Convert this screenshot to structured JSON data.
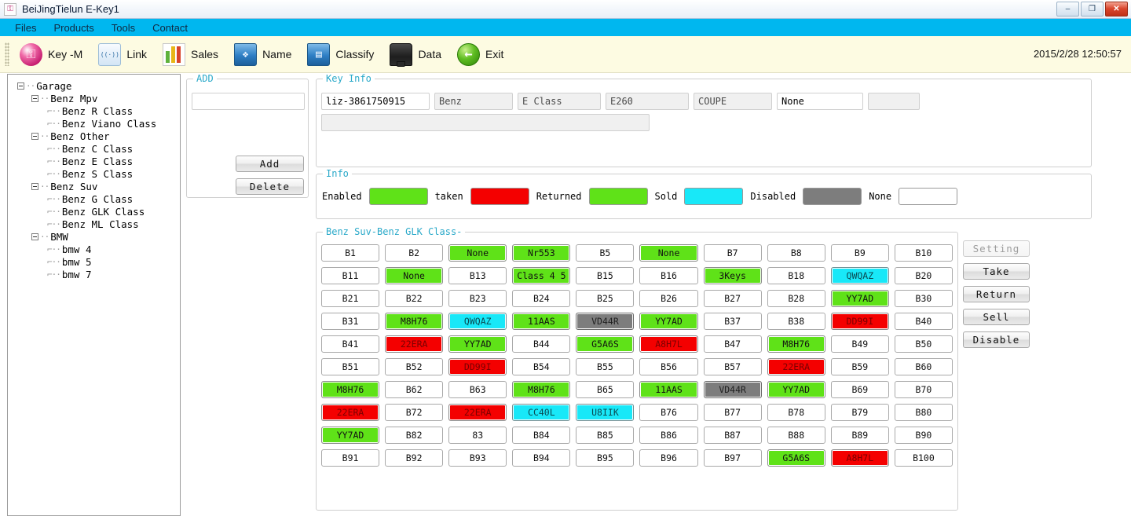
{
  "window": {
    "title": "BeiJingTielun E-Key1",
    "app_icon": "key-app-icon",
    "minimize": "–",
    "maximize": "❐",
    "close": "✕"
  },
  "menubar": {
    "items": [
      {
        "label": "Files"
      },
      {
        "label": "Products"
      },
      {
        "label": "Tools"
      },
      {
        "label": "Contact"
      }
    ]
  },
  "toolbar": {
    "items": [
      {
        "label": "Key -M",
        "icon": "key-icon"
      },
      {
        "label": "Link",
        "icon": "router-icon"
      },
      {
        "label": "Sales",
        "icon": "bar-chart-icon"
      },
      {
        "label": "Name",
        "icon": "blue-folder-icon"
      },
      {
        "label": "Classify",
        "icon": "blue-folder-open-icon"
      },
      {
        "label": "Data",
        "icon": "hard-drive-icon"
      },
      {
        "label": "Exit",
        "icon": "green-back-arrow-icon"
      }
    ],
    "clock": "2015/2/28  12:50:57"
  },
  "tree": {
    "nodes": [
      {
        "label": "Garage",
        "depth": 0,
        "expander": true
      },
      {
        "label": "Benz Mpv",
        "depth": 1,
        "expander": true
      },
      {
        "label": "Benz R Class",
        "depth": 2,
        "expander": false
      },
      {
        "label": "Benz Viano Class",
        "depth": 2,
        "expander": false
      },
      {
        "label": "Benz Other",
        "depth": 1,
        "expander": true
      },
      {
        "label": "Benz C Class",
        "depth": 2,
        "expander": false
      },
      {
        "label": "Benz E Class",
        "depth": 2,
        "expander": false
      },
      {
        "label": "Benz S Class",
        "depth": 2,
        "expander": false
      },
      {
        "label": "Benz Suv",
        "depth": 1,
        "expander": true
      },
      {
        "label": "Benz G Class",
        "depth": 2,
        "expander": false
      },
      {
        "label": "Benz GLK Class",
        "depth": 2,
        "expander": false
      },
      {
        "label": "Benz ML Class",
        "depth": 2,
        "expander": false
      },
      {
        "label": "BMW",
        "depth": 1,
        "expander": true
      },
      {
        "label": "bmw 4",
        "depth": 2,
        "expander": false
      },
      {
        "label": "bmw 5",
        "depth": 2,
        "expander": false
      },
      {
        "label": "bmw 7",
        "depth": 2,
        "expander": false
      }
    ]
  },
  "add_panel": {
    "legend": "ADD",
    "input_value": "",
    "input_placeholder": "",
    "add_label": "Add",
    "delete_label": "Delete"
  },
  "key_info": {
    "legend": "Key Info",
    "fields": [
      {
        "value": "liz-3861750915",
        "state": "active"
      },
      {
        "value": "Benz",
        "state": "readonly"
      },
      {
        "value": "E Class",
        "state": "readonly"
      },
      {
        "value": "E260",
        "state": "readonly"
      },
      {
        "value": "COUPE",
        "state": "readonly"
      },
      {
        "value": "None",
        "state": "active"
      },
      {
        "value": "",
        "state": "readonly"
      }
    ],
    "wide_field": {
      "value": "",
      "state": "readonly"
    }
  },
  "info": {
    "legend": "Info",
    "items": [
      {
        "label": "Enabled",
        "color": "#5fe218"
      },
      {
        "label": "taken",
        "color": "#f40000"
      },
      {
        "label": "Returned",
        "color": "#5fe218"
      },
      {
        "label": "Sold",
        "color": "#18e8f8"
      },
      {
        "label": "Disabled",
        "color": "#7d7d7d"
      },
      {
        "label": "None",
        "color": "#ffffff"
      }
    ]
  },
  "keys_panel": {
    "legend": "Benz Suv-Benz GLK Class-",
    "columns": 10,
    "cells": [
      {
        "label": "B1",
        "state": "none"
      },
      {
        "label": "B2",
        "state": "none"
      },
      {
        "label": "None",
        "state": "green"
      },
      {
        "label": "Nr553",
        "state": "green"
      },
      {
        "label": "B5",
        "state": "none"
      },
      {
        "label": "None",
        "state": "green"
      },
      {
        "label": "B7",
        "state": "none"
      },
      {
        "label": "B8",
        "state": "none"
      },
      {
        "label": "B9",
        "state": "none"
      },
      {
        "label": "B10",
        "state": "none"
      },
      {
        "label": "B11",
        "state": "none"
      },
      {
        "label": "None",
        "state": "green"
      },
      {
        "label": "B13",
        "state": "none"
      },
      {
        "label": "Class 4 5",
        "state": "green"
      },
      {
        "label": "B15",
        "state": "none"
      },
      {
        "label": "B16",
        "state": "none"
      },
      {
        "label": "3Keys",
        "state": "green"
      },
      {
        "label": "B18",
        "state": "none"
      },
      {
        "label": "QWQAZ",
        "state": "cyan"
      },
      {
        "label": "B20",
        "state": "none"
      },
      {
        "label": "B21",
        "state": "none"
      },
      {
        "label": "B22",
        "state": "none"
      },
      {
        "label": "B23",
        "state": "none"
      },
      {
        "label": "B24",
        "state": "none"
      },
      {
        "label": "B25",
        "state": "none"
      },
      {
        "label": "B26",
        "state": "none"
      },
      {
        "label": "B27",
        "state": "none"
      },
      {
        "label": "B28",
        "state": "none"
      },
      {
        "label": "YY7AD",
        "state": "green"
      },
      {
        "label": "B30",
        "state": "none"
      },
      {
        "label": "B31",
        "state": "none"
      },
      {
        "label": "M8H76",
        "state": "green"
      },
      {
        "label": "QWQAZ",
        "state": "cyan"
      },
      {
        "label": "11AAS",
        "state": "green"
      },
      {
        "label": "VD44R",
        "state": "gray"
      },
      {
        "label": "YY7AD",
        "state": "green"
      },
      {
        "label": "B37",
        "state": "none"
      },
      {
        "label": "B38",
        "state": "none"
      },
      {
        "label": "DD99I",
        "state": "red"
      },
      {
        "label": "B40",
        "state": "none"
      },
      {
        "label": "B41",
        "state": "none"
      },
      {
        "label": "22ERA",
        "state": "red"
      },
      {
        "label": "YY7AD",
        "state": "green"
      },
      {
        "label": "B44",
        "state": "none"
      },
      {
        "label": "G5A6S",
        "state": "green"
      },
      {
        "label": "A8H7L",
        "state": "red"
      },
      {
        "label": "B47",
        "state": "none"
      },
      {
        "label": "M8H76",
        "state": "green"
      },
      {
        "label": "B49",
        "state": "none"
      },
      {
        "label": "B50",
        "state": "none"
      },
      {
        "label": "B51",
        "state": "none"
      },
      {
        "label": "B52",
        "state": "none"
      },
      {
        "label": "DD99I",
        "state": "red"
      },
      {
        "label": "B54",
        "state": "none"
      },
      {
        "label": "B55",
        "state": "none"
      },
      {
        "label": "B56",
        "state": "none"
      },
      {
        "label": "B57",
        "state": "none"
      },
      {
        "label": "22ERA",
        "state": "red"
      },
      {
        "label": "B59",
        "state": "none"
      },
      {
        "label": "B60",
        "state": "none"
      },
      {
        "label": "M8H76",
        "state": "green"
      },
      {
        "label": "B62",
        "state": "none"
      },
      {
        "label": "B63",
        "state": "none"
      },
      {
        "label": "M8H76",
        "state": "green"
      },
      {
        "label": "B65",
        "state": "none"
      },
      {
        "label": "11AAS",
        "state": "green"
      },
      {
        "label": "VD44R",
        "state": "gray"
      },
      {
        "label": "YY7AD",
        "state": "green"
      },
      {
        "label": "B69",
        "state": "none"
      },
      {
        "label": "B70",
        "state": "none"
      },
      {
        "label": "22ERA",
        "state": "red"
      },
      {
        "label": "B72",
        "state": "none"
      },
      {
        "label": "22ERA",
        "state": "red"
      },
      {
        "label": "CC40L",
        "state": "cyan"
      },
      {
        "label": "U8IIK",
        "state": "cyan"
      },
      {
        "label": "B76",
        "state": "none"
      },
      {
        "label": "B77",
        "state": "none"
      },
      {
        "label": "B78",
        "state": "none"
      },
      {
        "label": "B79",
        "state": "none"
      },
      {
        "label": "B80",
        "state": "none"
      },
      {
        "label": "YY7AD",
        "state": "green"
      },
      {
        "label": "B82",
        "state": "none"
      },
      {
        "label": "83",
        "state": "none"
      },
      {
        "label": "B84",
        "state": "none"
      },
      {
        "label": "B85",
        "state": "none"
      },
      {
        "label": "B86",
        "state": "none"
      },
      {
        "label": "B87",
        "state": "none"
      },
      {
        "label": "B88",
        "state": "none"
      },
      {
        "label": "B89",
        "state": "none"
      },
      {
        "label": "B90",
        "state": "none"
      },
      {
        "label": "B91",
        "state": "none"
      },
      {
        "label": "B92",
        "state": "none"
      },
      {
        "label": "B93",
        "state": "none"
      },
      {
        "label": "B94",
        "state": "none"
      },
      {
        "label": "B95",
        "state": "none"
      },
      {
        "label": "B96",
        "state": "none"
      },
      {
        "label": "B97",
        "state": "none"
      },
      {
        "label": "G5A6S",
        "state": "green"
      },
      {
        "label": "A8H7L",
        "state": "red"
      },
      {
        "label": "B100",
        "state": "none"
      }
    ]
  },
  "actions": {
    "buttons": [
      {
        "label": "Setting",
        "enabled": false
      },
      {
        "label": "Take",
        "enabled": true
      },
      {
        "label": "Return",
        "enabled": true
      },
      {
        "label": "Sell",
        "enabled": true
      },
      {
        "label": "Disable",
        "enabled": true
      }
    ]
  }
}
